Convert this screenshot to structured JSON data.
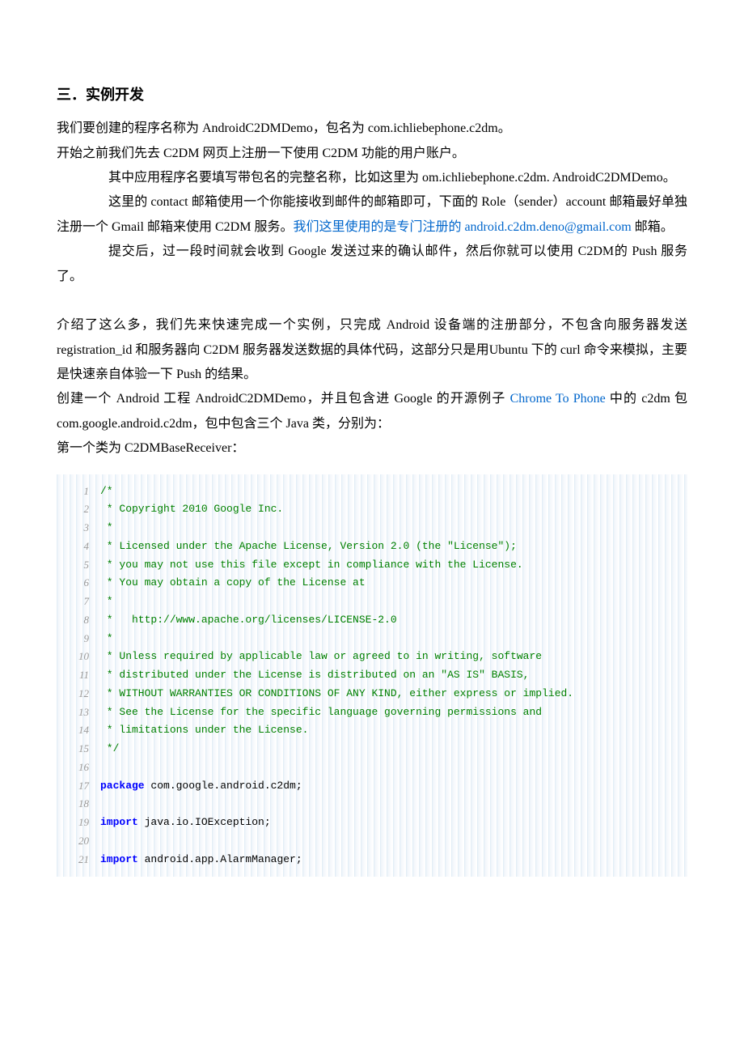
{
  "heading": "三．实例开发",
  "prose": {
    "p1": "我们要创建的程序名称为 AndroidC2DMDemo，包名为 com.ichliebephone.c2dm。",
    "p2": "开始之前我们先去 C2DM 网页上注册一下使用 C2DM 功能的用户账户。",
    "p3": "其中应用程序名要填写带包名的完整名称，比如这里为 om.ichliebephone.c2dm. AndroidC2DMDemo。",
    "p4a": "这里的 contact 邮箱使用一个你能接收到邮件的邮箱即可，下面的 Role（sender）account 邮箱最好单独注册一个 Gmail 邮箱来使用 C2DM 服务。",
    "p4b_link": "我们这里使用的是专门注册的 android.c2dm.deno@gmail.com",
    "p4c": " 邮箱。",
    "p5": "提交后，过一段时间就会收到 Google 发送过来的确认邮件，然后你就可以使用 C2DM的 Push 服务了。",
    "p6": "介绍了这么多，我们先来快速完成一个实例，只完成 Android 设备端的注册部分，不包含向服务器发送 registration_id 和服务器向 C2DM 服务器发送数据的具体代码，这部分只是用Ubuntu 下的 curl 命令来模拟，主要是快速亲自体验一下 Push 的结果。",
    "p7a": "创建一个 Android 工程 AndroidC2DMDemo，并且包含进 Google 的开源例子 ",
    "p7b_link": "Chrome To Phone",
    "p7c": " 中的 c2dm 包 com.google.android.c2dm，包中包含三个 Java 类，分别为：",
    "p8": "第一个类为 C2DMBaseReceiver："
  },
  "code": {
    "lines": [
      {
        "n": 1,
        "cls": "comment",
        "t": "/*"
      },
      {
        "n": 2,
        "cls": "comment",
        "t": " * Copyright 2010 Google Inc."
      },
      {
        "n": 3,
        "cls": "comment",
        "t": " *"
      },
      {
        "n": 4,
        "cls": "comment",
        "t": " * Licensed under the Apache License, Version 2.0 (the \"License\");"
      },
      {
        "n": 5,
        "cls": "comment",
        "t": " * you may not use this file except in compliance with the License."
      },
      {
        "n": 6,
        "cls": "comment",
        "t": " * You may obtain a copy of the License at"
      },
      {
        "n": 7,
        "cls": "comment",
        "t": " *"
      },
      {
        "n": 8,
        "cls": "comment",
        "t": " *   http://www.apache.org/licenses/LICENSE-2.0"
      },
      {
        "n": 9,
        "cls": "comment",
        "t": " *"
      },
      {
        "n": 10,
        "cls": "comment",
        "t": " * Unless required by applicable law or agreed to in writing, software"
      },
      {
        "n": 11,
        "cls": "comment",
        "t": " * distributed under the License is distributed on an \"AS IS\" BASIS,"
      },
      {
        "n": 12,
        "cls": "comment",
        "t": " * WITHOUT WARRANTIES OR CONDITIONS OF ANY KIND, either express or implied."
      },
      {
        "n": 13,
        "cls": "comment",
        "t": " * See the License for the specific language governing permissions and"
      },
      {
        "n": 14,
        "cls": "comment",
        "t": " * limitations under the License."
      },
      {
        "n": 15,
        "cls": "comment",
        "t": " */"
      },
      {
        "n": 16,
        "cls": "normal",
        "t": ""
      },
      {
        "n": 17,
        "cls": "mixed",
        "kw": "package",
        "rest": " com.google.android.c2dm;"
      },
      {
        "n": 18,
        "cls": "normal",
        "t": ""
      },
      {
        "n": 19,
        "cls": "mixed",
        "kw": "import",
        "rest": " java.io.IOException;"
      },
      {
        "n": 20,
        "cls": "normal",
        "t": ""
      },
      {
        "n": 21,
        "cls": "mixed",
        "kw": "import",
        "rest": " android.app.AlarmManager;"
      }
    ]
  }
}
